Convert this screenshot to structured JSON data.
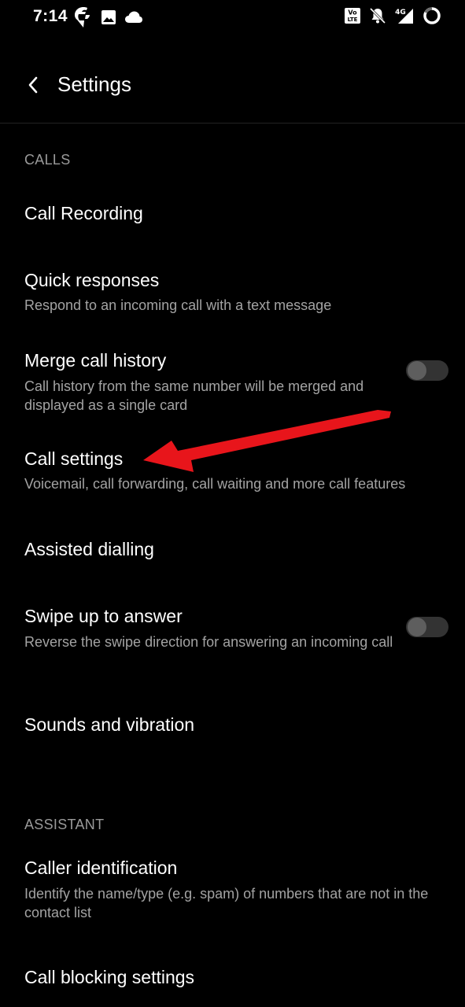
{
  "status_bar": {
    "time": "7:14",
    "left_icons": [
      "swiggy-icon",
      "image-icon",
      "cloud-icon"
    ],
    "right_icons": [
      "volte-icon",
      "bell-off-icon",
      "signal-4g-icon",
      "battery-ring-icon"
    ],
    "network_label": "4G",
    "volte_label_top": "Vo",
    "volte_label_bottom": "LTE"
  },
  "app_bar": {
    "title": "Settings"
  },
  "sections": {
    "calls": {
      "header": "CALLS",
      "call_recording": {
        "title": "Call Recording"
      },
      "quick_responses": {
        "title": "Quick responses",
        "subtitle": "Respond to an incoming call with a text message"
      },
      "merge_call_history": {
        "title": "Merge call history",
        "subtitle": "Call history from the same number will be merged and displayed as a single card",
        "toggle_on": false
      },
      "call_settings": {
        "title": "Call settings",
        "subtitle": "Voicemail, call forwarding, call waiting and more call features"
      },
      "assisted_dialling": {
        "title": "Assisted dialling"
      },
      "swipe_up_to_answer": {
        "title": "Swipe up to answer",
        "subtitle": "Reverse the swipe direction for answering an incoming call",
        "toggle_on": false
      },
      "sounds_and_vibration": {
        "title": "Sounds and vibration"
      }
    },
    "assistant": {
      "header": "ASSISTANT",
      "caller_identification": {
        "title": "Caller identification",
        "subtitle": "Identify the name/type (e.g. spam) of numbers that are not in the contact list"
      },
      "call_blocking_settings": {
        "title": "Call blocking settings"
      }
    }
  },
  "colors": {
    "background": "#000000",
    "text_primary": "#ffffff",
    "text_secondary": "#a3a3a3",
    "section_header": "#9a9a9a",
    "toggle_track": "#333333",
    "toggle_thumb": "#5e5e5e",
    "annotation_arrow": "#e8151b"
  }
}
